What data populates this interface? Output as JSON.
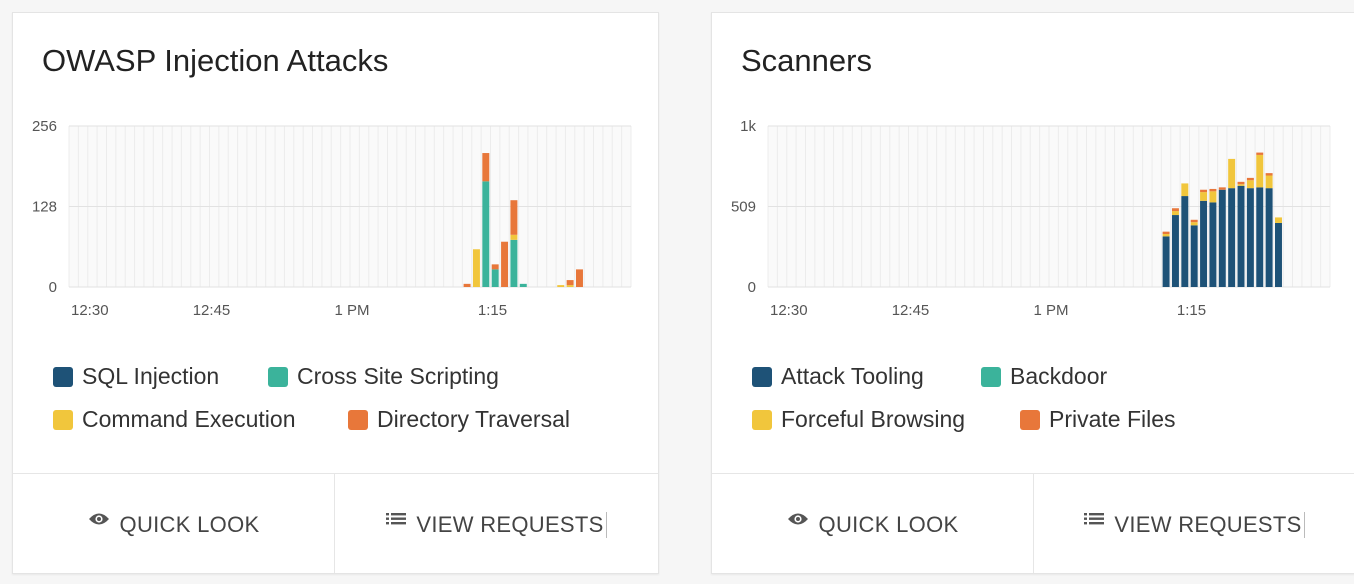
{
  "cards": [
    {
      "title": "OWASP Injection Attacks",
      "legend": [
        {
          "label": "SQL Injection",
          "color": "#1e5277"
        },
        {
          "label": "Cross Site Scripting",
          "color": "#3bb39b"
        },
        {
          "label": "Command Execution",
          "color": "#f1c63c"
        },
        {
          "label": "Directory Traversal",
          "color": "#e8773a"
        }
      ],
      "actions": {
        "quick_look": "QUICK LOOK",
        "view_requests": "VIEW REQUESTS",
        "quick_look_icon": "eye-icon",
        "view_requests_icon": "list-icon"
      }
    },
    {
      "title": "Scanners",
      "legend": [
        {
          "label": "Attack Tooling",
          "color": "#1e5277"
        },
        {
          "label": "Backdoor",
          "color": "#3bb39b"
        },
        {
          "label": "Forceful Browsing",
          "color": "#f1c63c"
        },
        {
          "label": "Private Files",
          "color": "#e8773a"
        }
      ],
      "actions": {
        "quick_look": "QUICK LOOK",
        "view_requests": "VIEW REQUESTS",
        "quick_look_icon": "eye-icon",
        "view_requests_icon": "list-icon"
      }
    }
  ],
  "chart_data": [
    {
      "type": "bar",
      "stacked": true,
      "ylim": [
        0,
        256
      ],
      "yticks": [
        "0",
        "128",
        "256"
      ],
      "xticks": [
        "12:30",
        "12:45",
        "1 PM",
        "1:15"
      ],
      "grid": true,
      "series_names": [
        "SQL Injection",
        "Cross Site Scripting",
        "Command Execution",
        "Directory Traversal"
      ],
      "colors": [
        "#1e5277",
        "#3bb39b",
        "#f1c63c",
        "#e8773a"
      ],
      "slot_count": 60,
      "bars": [
        {
          "slot": 42,
          "values": [
            0,
            0,
            0,
            5
          ]
        },
        {
          "slot": 43,
          "values": [
            0,
            0,
            60,
            0
          ]
        },
        {
          "slot": 44,
          "values": [
            0,
            168,
            0,
            45
          ]
        },
        {
          "slot": 45,
          "values": [
            0,
            28,
            0,
            8
          ]
        },
        {
          "slot": 46,
          "values": [
            0,
            0,
            0,
            72
          ]
        },
        {
          "slot": 47,
          "values": [
            0,
            75,
            8,
            55
          ]
        },
        {
          "slot": 48,
          "values": [
            0,
            5,
            0,
            0
          ]
        },
        {
          "slot": 52,
          "values": [
            0,
            0,
            3,
            0
          ]
        },
        {
          "slot": 53,
          "values": [
            0,
            0,
            3,
            8
          ]
        },
        {
          "slot": 54,
          "values": [
            0,
            0,
            0,
            28
          ]
        }
      ]
    },
    {
      "type": "bar",
      "stacked": true,
      "ylim": [
        0,
        1018
      ],
      "yticks": [
        "0",
        "509",
        "1k"
      ],
      "xticks": [
        "12:30",
        "12:45",
        "1 PM",
        "1:15"
      ],
      "grid": true,
      "series_names": [
        "Attack Tooling",
        "Backdoor",
        "Forceful Browsing",
        "Private Files"
      ],
      "colors": [
        "#1e5277",
        "#3bb39b",
        "#f1c63c",
        "#e8773a"
      ],
      "slot_count": 60,
      "bars": [
        {
          "slot": 42,
          "values": [
            320,
            0,
            15,
            15
          ]
        },
        {
          "slot": 43,
          "values": [
            455,
            0,
            25,
            18
          ]
        },
        {
          "slot": 44,
          "values": [
            575,
            0,
            80,
            0
          ]
        },
        {
          "slot": 45,
          "values": [
            390,
            0,
            20,
            15
          ]
        },
        {
          "slot": 46,
          "values": [
            545,
            0,
            55,
            15
          ]
        },
        {
          "slot": 47,
          "values": [
            535,
            0,
            70,
            15
          ]
        },
        {
          "slot": 48,
          "values": [
            615,
            0,
            0,
            15
          ]
        },
        {
          "slot": 49,
          "values": [
            625,
            0,
            185,
            0
          ]
        },
        {
          "slot": 50,
          "values": [
            640,
            0,
            10,
            15
          ]
        },
        {
          "slot": 51,
          "values": [
            625,
            0,
            50,
            15
          ]
        },
        {
          "slot": 52,
          "values": [
            630,
            0,
            205,
            15
          ]
        },
        {
          "slot": 53,
          "values": [
            625,
            0,
            80,
            15
          ]
        },
        {
          "slot": 54,
          "values": [
            405,
            0,
            35,
            0
          ]
        }
      ]
    }
  ]
}
